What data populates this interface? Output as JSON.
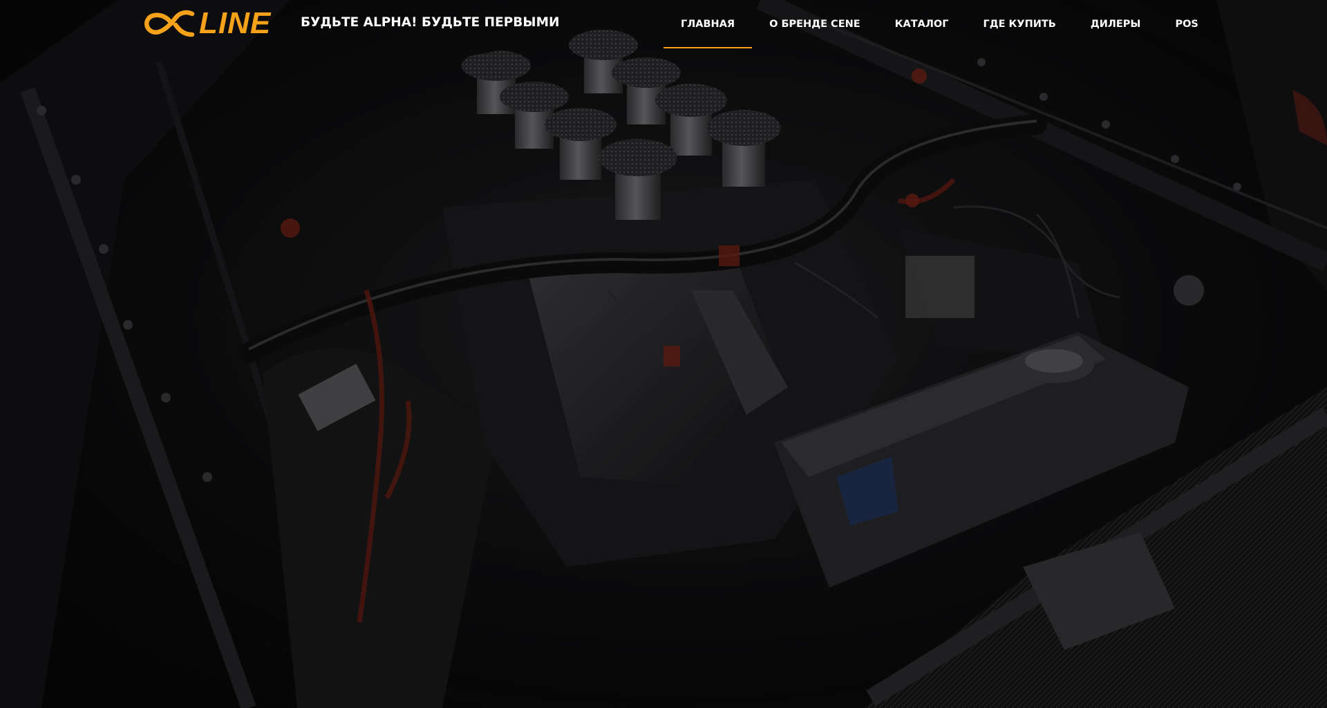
{
  "brand": {
    "logo_text": "LINE",
    "slogan": "БУДЬТЕ ALPHA! БУДЬТЕ ПЕРВЫМИ",
    "accent_color": "#f6a11a"
  },
  "nav": {
    "items": [
      {
        "label": "ГЛАВНАЯ",
        "active": true
      },
      {
        "label": "О БРЕНДЕ CENE",
        "active": false
      },
      {
        "label": "КАТАЛОГ",
        "active": false
      },
      {
        "label": "ГДЕ КУПИТЬ",
        "active": false
      },
      {
        "label": "ДИЛЕРЫ",
        "active": false
      },
      {
        "label": "POS",
        "active": false
      }
    ]
  },
  "hero": {
    "image": "engine-bay-photo",
    "style": "dark-overlay"
  }
}
